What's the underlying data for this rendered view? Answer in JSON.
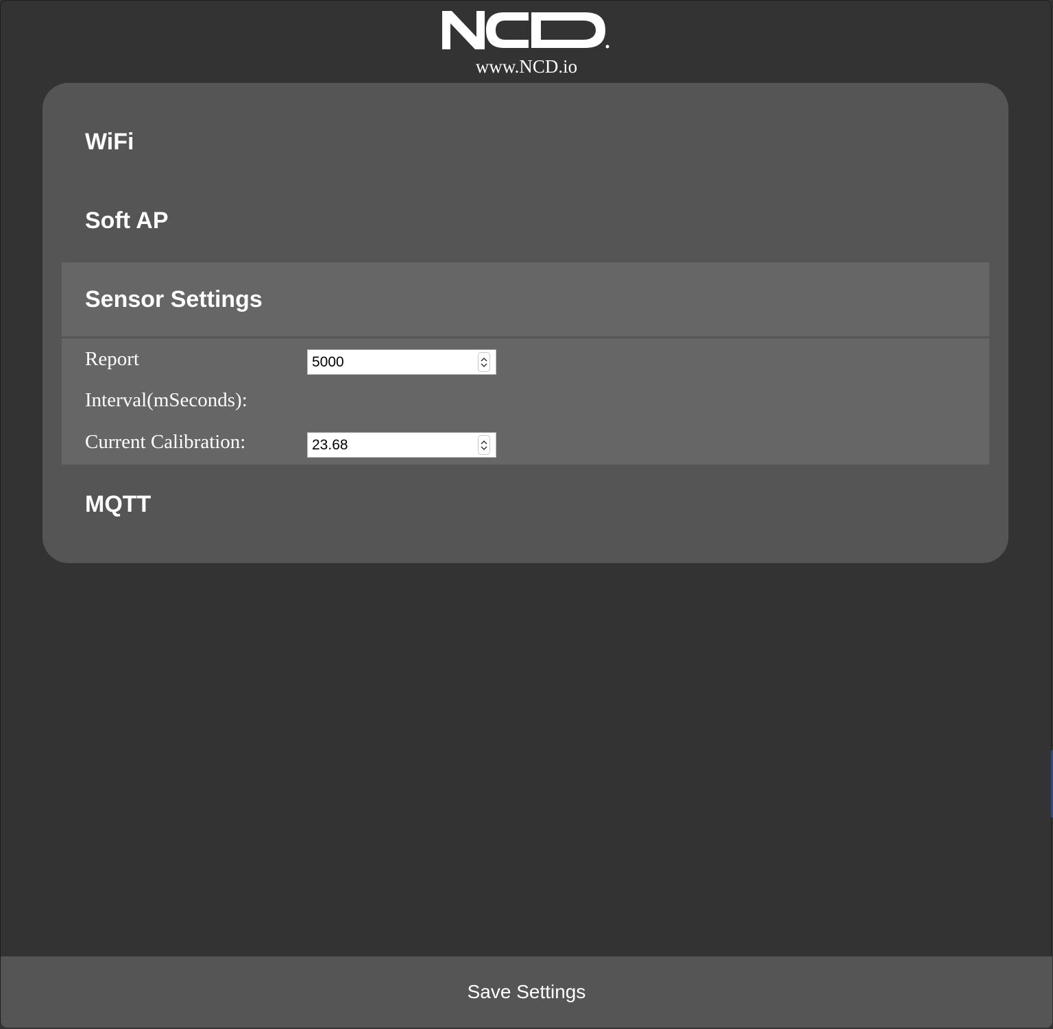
{
  "header": {
    "logo_text": "NCD",
    "site_url": "www.NCD.io"
  },
  "sections": {
    "wifi": "WiFi",
    "soft_ap": "Soft AP",
    "sensor_settings": "Sensor Settings",
    "mqtt": "MQTT"
  },
  "sensor": {
    "report_label_line1": "Report",
    "report_label_line2": "Interval(mSeconds):",
    "report_value": "5000",
    "calibration_label": "Current Calibration:",
    "calibration_value": "23.68"
  },
  "footer": {
    "save_label": "Save Settings"
  },
  "colors": {
    "background": "#333333",
    "panel": "#555555",
    "active_section": "#666666",
    "text": "#ffffff"
  }
}
